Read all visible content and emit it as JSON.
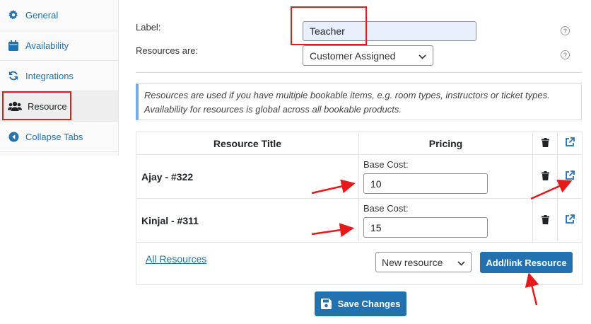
{
  "sidebar": {
    "items": [
      {
        "label": "General",
        "icon": "gear-icon"
      },
      {
        "label": "Availability",
        "icon": "calendar-icon"
      },
      {
        "label": "Integrations",
        "icon": "sync-icon"
      },
      {
        "label": "Resource",
        "icon": "users-icon"
      },
      {
        "label": "Collapse Tabs",
        "icon": "collapse-icon"
      }
    ],
    "active_index": 3
  },
  "form": {
    "label_text": "Label:",
    "label_value": "Teacher",
    "resources_text": "Resources are:",
    "resources_value": "Customer Assigned",
    "help_glyph": "?"
  },
  "notice": {
    "text": "Resources are used if you have multiple bookable items, e.g. room types, instructors or ticket types. Availability for resources is global across all bookable products."
  },
  "table": {
    "headers": [
      "Resource Title",
      "Pricing"
    ],
    "base_cost_label": "Base Cost:",
    "rows": [
      {
        "title": "Ajay - #322",
        "base_cost": "10"
      },
      {
        "title": "Kinjal - #311",
        "base_cost": "15"
      }
    ]
  },
  "footer": {
    "all_resources_link": "All Resources",
    "new_resource_select": "New resource",
    "add_link_button": "Add/link Resource"
  },
  "save_button": "Save Changes",
  "colors": {
    "accent": "#2271b1",
    "annotation_red": "#e8191a"
  }
}
